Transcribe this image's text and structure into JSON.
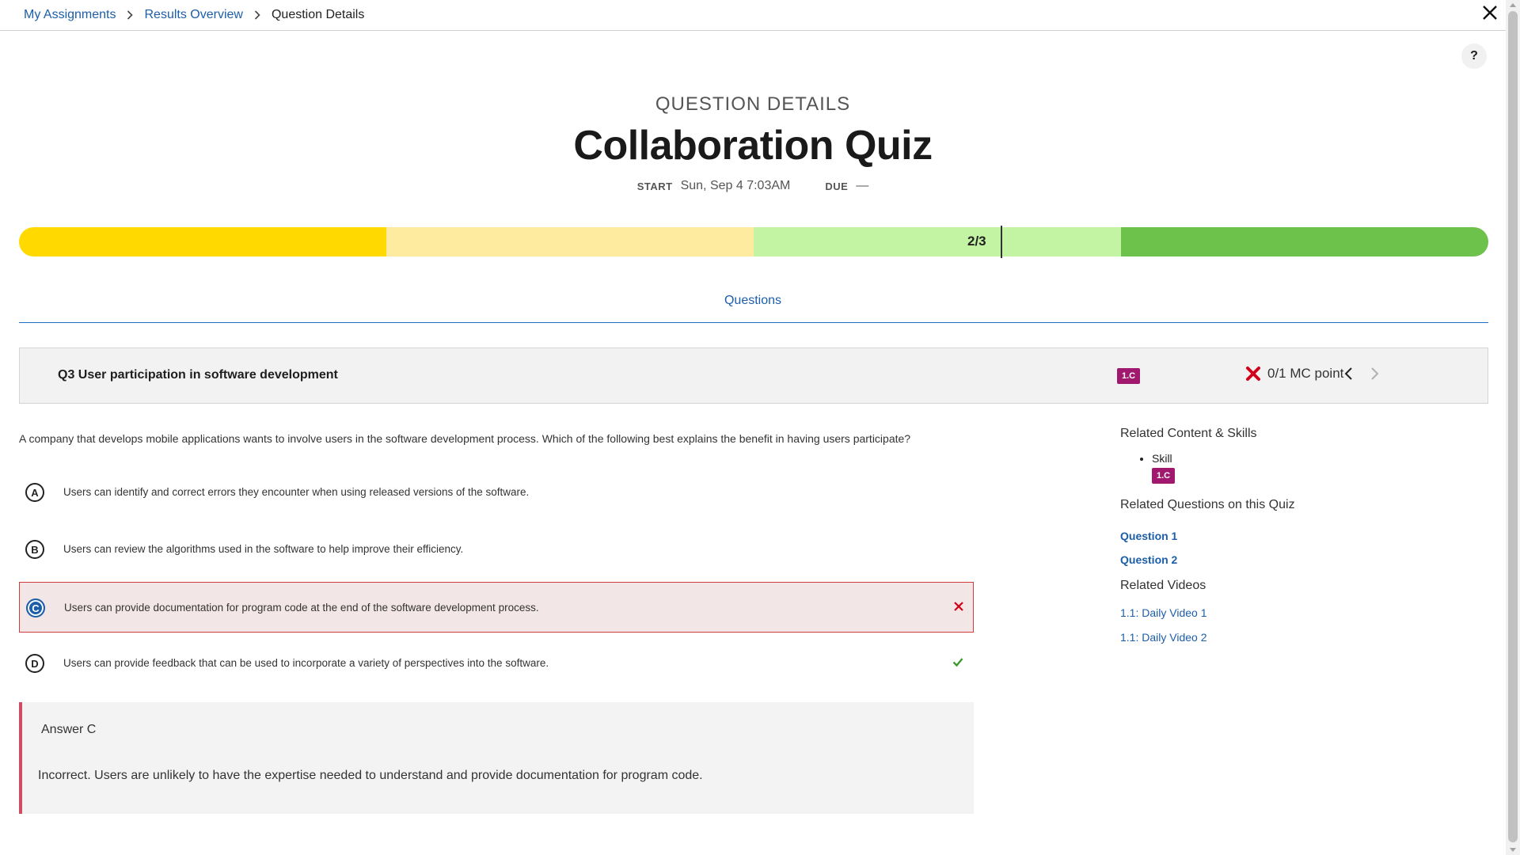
{
  "breadcrumb": {
    "items": [
      {
        "label": "My Assignments"
      },
      {
        "label": "Results Overview"
      },
      {
        "label": "Question Details"
      }
    ]
  },
  "help": {
    "label": "?"
  },
  "header": {
    "subtitle": "QUESTION DETAILS",
    "title": "Collaboration Quiz",
    "start_label": "START",
    "start_value": "Sun, Sep 4 7:03AM",
    "due_label": "DUE",
    "due_value": "—"
  },
  "progress": {
    "label": "2/3",
    "value_fraction": 0.667,
    "bands": [
      {
        "color": "#ffd900"
      },
      {
        "color": "#ffeba0"
      },
      {
        "color": "#c2f4a3"
      },
      {
        "color": "#6cc24a"
      }
    ]
  },
  "tabs": {
    "questions": "Questions"
  },
  "question": {
    "title": "Q3 User participation in software development",
    "skill": "1.C",
    "score": "0/1 MC point",
    "prompt": "A company that develops mobile applications wants to involve users in the software development process. Which of the following best explains the benefit in having users participate?",
    "options": [
      {
        "letter": "A",
        "text": "Users can identify and correct errors they encounter when using released versions of the software."
      },
      {
        "letter": "B",
        "text": "Users can review the algorithms used in the software to help improve their efficiency."
      },
      {
        "letter": "C",
        "text": "Users can provide documentation for program code at the end of the software development process."
      },
      {
        "letter": "D",
        "text": "Users can provide feedback that can be used to incorporate a variety of perspectives into the software."
      }
    ],
    "selected": "C",
    "correct": "D"
  },
  "explanation": {
    "title": "Answer C",
    "text": "Incorrect. Users are unlikely to have the expertise needed to understand and provide documentation for program code."
  },
  "sidebar": {
    "content_heading": "Related Content & Skills",
    "skill_label": "Skill",
    "skill_badge": "1.C",
    "questions_heading": "Related Questions on this Quiz",
    "questions": [
      {
        "label": "Question 1"
      },
      {
        "label": "Question 2"
      }
    ],
    "videos_heading": "Related Videos",
    "videos": [
      {
        "label": "1.1: Daily Video 1"
      },
      {
        "label": "1.1: Daily Video 2"
      }
    ]
  },
  "colors": {
    "link": "#1c5ea8",
    "skill_badge": "#a1186f",
    "incorrect": "#d0021b",
    "correct": "#3a9b2a"
  }
}
